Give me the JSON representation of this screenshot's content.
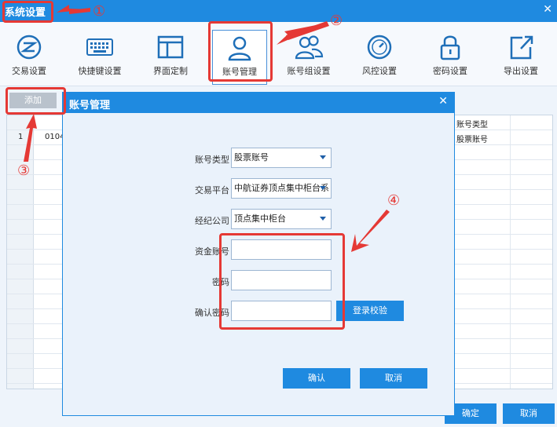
{
  "window": {
    "title": "系统设置",
    "close_icon": "close-icon"
  },
  "toolbar": {
    "items": [
      {
        "label": "交易设置",
        "icon": "trade-settings-icon"
      },
      {
        "label": "快捷键设置",
        "icon": "keyboard-icon"
      },
      {
        "label": "界面定制",
        "icon": "layout-icon"
      },
      {
        "label": "账号管理",
        "icon": "user-icon"
      },
      {
        "label": "账号组设置",
        "icon": "user-group-icon"
      },
      {
        "label": "风控设置",
        "icon": "gauge-icon"
      },
      {
        "label": "密码设置",
        "icon": "lock-icon"
      },
      {
        "label": "导出设置",
        "icon": "export-icon"
      }
    ]
  },
  "main": {
    "add_label": "添加",
    "table": {
      "header_account_type": "账号类型",
      "row1_index": "1",
      "row1_account": "0104",
      "row1_type": "股票账号"
    },
    "ok_label": "确定",
    "cancel_label": "取消"
  },
  "modal": {
    "title": "账号管理",
    "fields": {
      "account_type_label": "账号类型",
      "account_type_value": "股票账号",
      "platform_label": "交易平台",
      "platform_value": "中航证券顶点集中柜台系",
      "broker_label": "经纪公司",
      "broker_value": "顶点集中柜台",
      "fund_account_label": "资金账号",
      "password_label": "密码",
      "confirm_password_label": "确认密码"
    },
    "verify_label": "登录校验",
    "ok_label": "确认",
    "cancel_label": "取消"
  },
  "annotations": {
    "n1": "①",
    "n2": "②",
    "n3": "③",
    "n4": "④"
  },
  "colors": {
    "accent": "#1f8ae0",
    "annotation": "#e53935"
  }
}
